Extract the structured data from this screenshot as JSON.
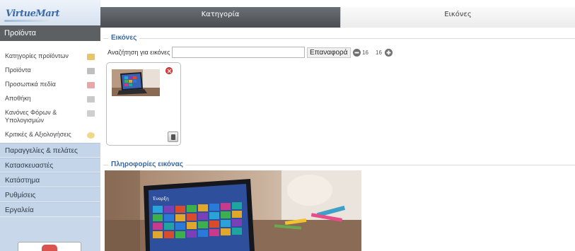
{
  "sidebar": {
    "logo": "VirtueMart",
    "active_section": "Προϊόντα",
    "sub_items": [
      {
        "label": "Κατηγορίες προϊόντων",
        "icon": "folder-icon"
      },
      {
        "label": "Προϊόντα",
        "icon": "product-icon"
      },
      {
        "label": "Προσωπικά πεδία",
        "icon": "custom-fields-icon"
      },
      {
        "label": "Αποθήκη",
        "icon": "inventory-icon"
      },
      {
        "label": "Κανόνες Φόρων & Υπολογισμών",
        "icon": "calculator-icon"
      },
      {
        "label": "Κριτικές & Αξιολογήσεις",
        "icon": "comment-icon"
      }
    ],
    "menu": [
      {
        "label": "Παραγγελίες & πελάτες"
      },
      {
        "label": "Κατασκευαστές"
      },
      {
        "label": "Κατάστημα"
      },
      {
        "label": "Ρυθμίσεις"
      },
      {
        "label": "Εργαλεία"
      }
    ]
  },
  "tabs": [
    {
      "label": "Κατηγορία",
      "active": true
    },
    {
      "label": "Εικόνες",
      "active": false
    }
  ],
  "images_section": {
    "legend": "Εικόνες",
    "search_label": "Αναζήτηση για εικόνες",
    "search_value": "",
    "reset_label": "Επαναφορά",
    "prev_count": "16",
    "next_count": "16"
  },
  "info_section": {
    "legend": "Πληροφορίες εικόνας"
  },
  "colors": {
    "legend": "#3a66a3",
    "sidebar": "#c8d7ea",
    "active_tab": "#55595d"
  }
}
